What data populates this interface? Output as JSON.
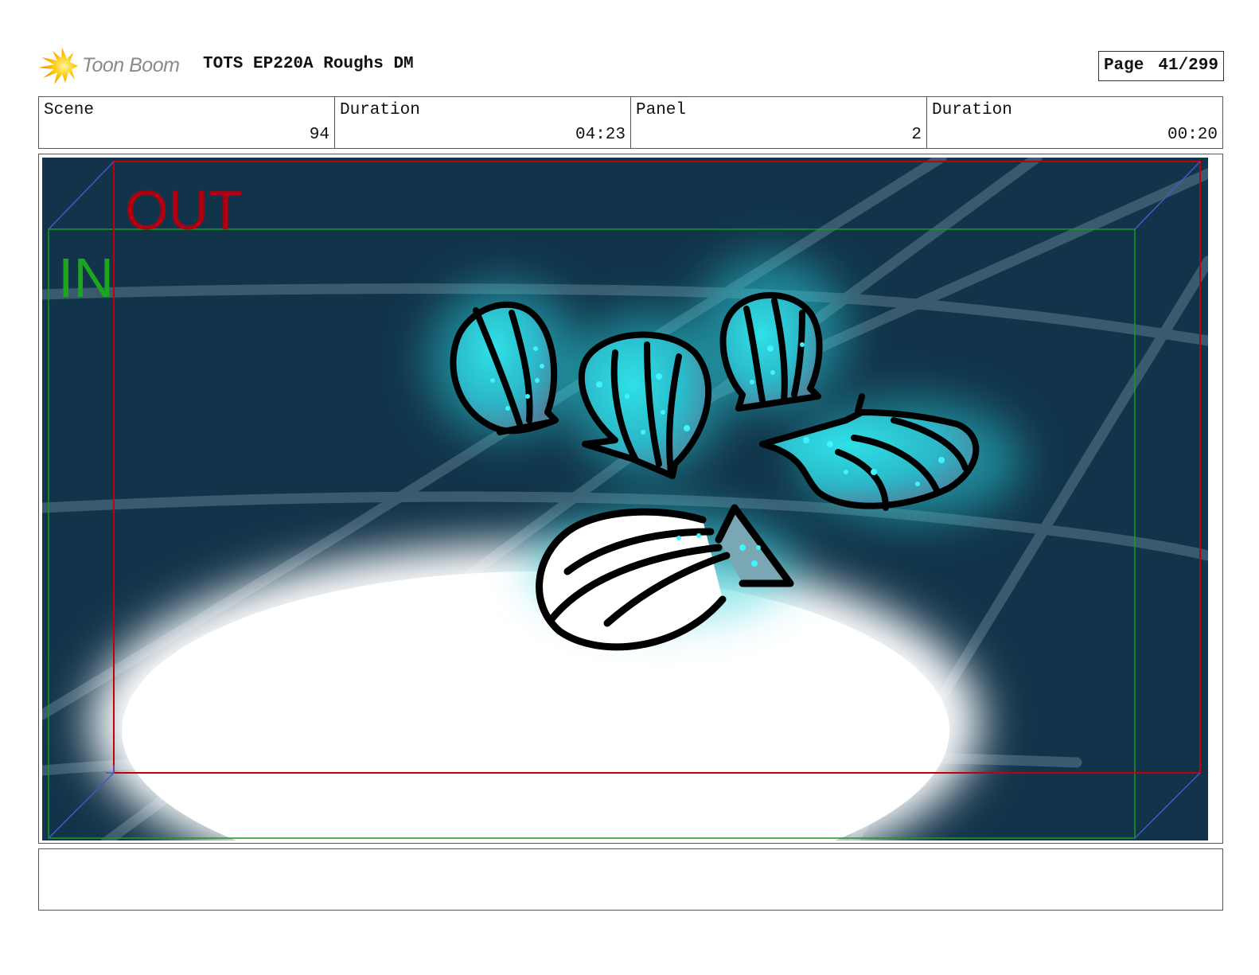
{
  "header": {
    "logo_text": "Toon Boom",
    "logo_icon": "starburst-icon",
    "title": "TOTS EP220A Roughs DM",
    "page_label": "Page",
    "page_value": "41/299"
  },
  "info": [
    {
      "label": "Scene",
      "value": "94"
    },
    {
      "label": "Duration",
      "value": "04:23"
    },
    {
      "label": "Panel",
      "value": "2"
    },
    {
      "label": "Duration",
      "value": "00:20"
    }
  ],
  "panel": {
    "out_label": "OUT",
    "in_label": "IN",
    "background_color": "#12344a",
    "shell_color": "#2ccfd8",
    "out_frame_color": "#c0000c",
    "in_frame_color": "#1a9a1a"
  },
  "notes": {
    "text": ""
  }
}
